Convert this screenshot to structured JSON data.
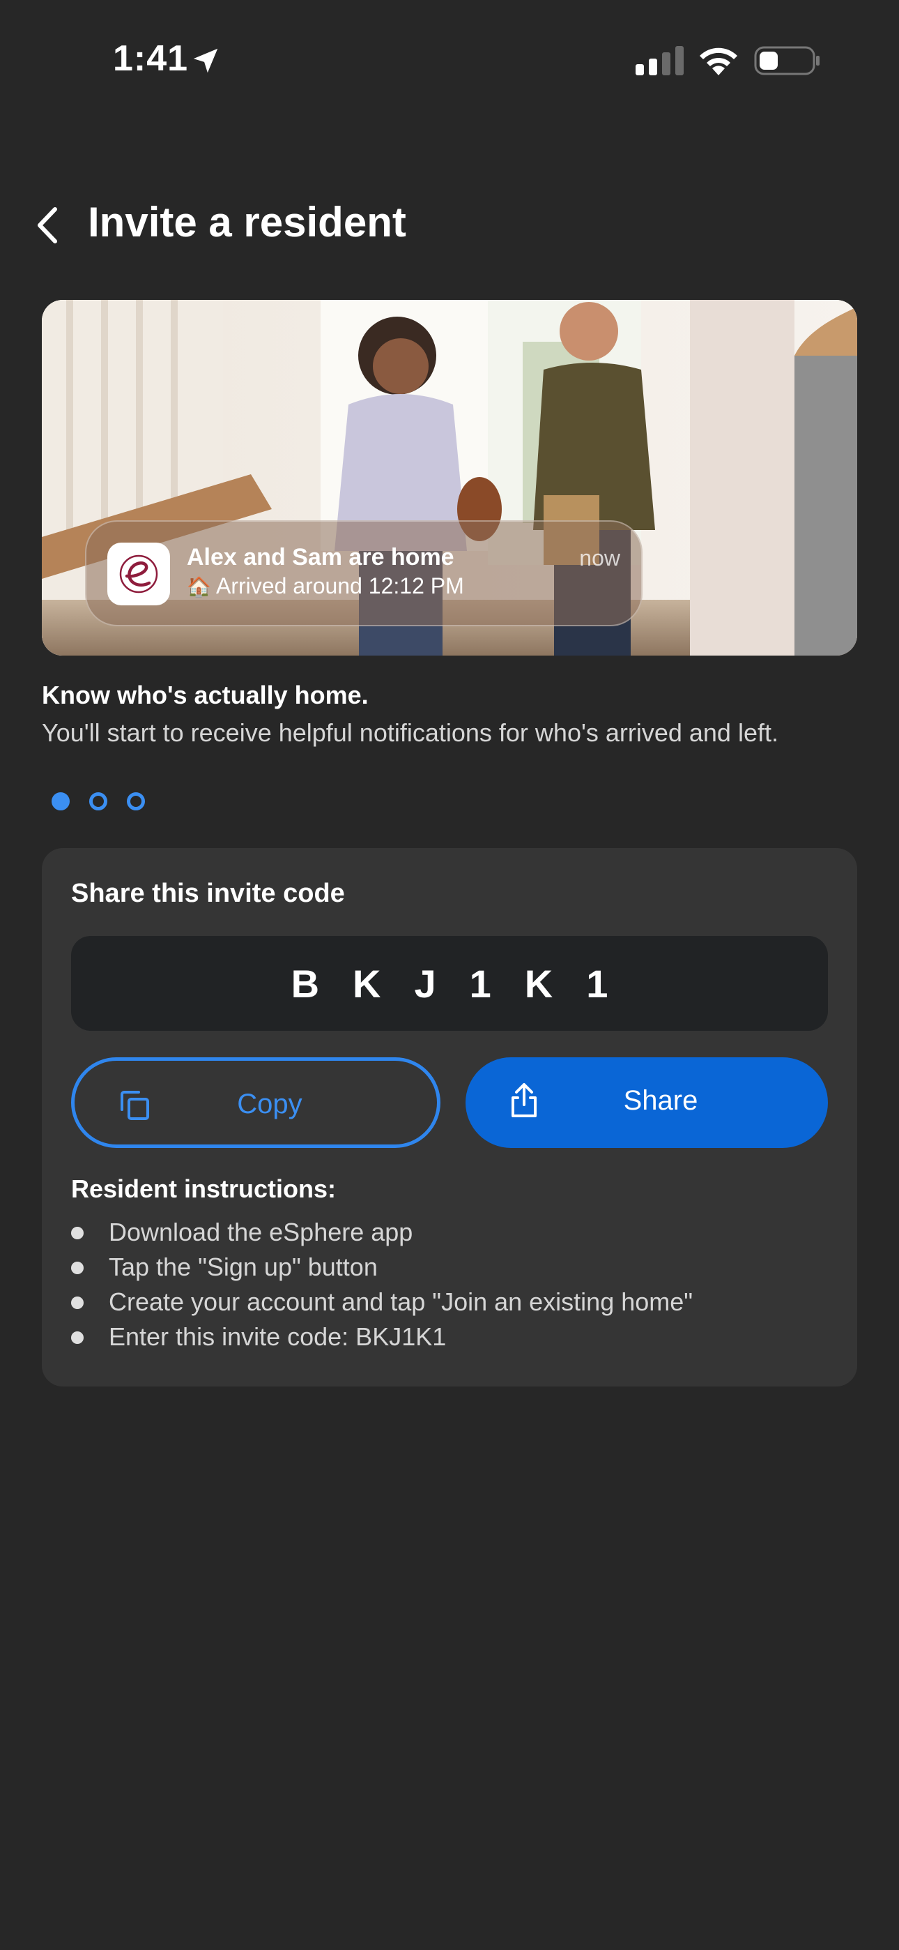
{
  "status_bar": {
    "time": "1:41"
  },
  "header": {
    "title": "Invite a resident"
  },
  "hero": {
    "notification": {
      "title": "Alex and Sam are home",
      "subtitle": "Arrived around 12:12 PM",
      "time": "now"
    }
  },
  "onboarding": {
    "heading": "Know who's actually home.",
    "description": "You'll start to receive helpful notifications for who's arrived and left.",
    "pager": {
      "current": 1,
      "total": 3
    }
  },
  "invite": {
    "heading": "Share this invite code",
    "code": "BKJ1K1",
    "copy_label": "Copy",
    "share_label": "Share",
    "instructions_heading": "Resident instructions:",
    "instructions": [
      "Download the eSphere app",
      "Tap the \"Sign up\" button",
      "Create your account and tap \"Join an existing home\"",
      "Enter this invite code: BKJ1K1"
    ]
  },
  "colors": {
    "background": "#272727",
    "card": "#353535",
    "code_box": "#212325",
    "accent": "#0a66d6",
    "accent_light": "#3b8ff2"
  }
}
